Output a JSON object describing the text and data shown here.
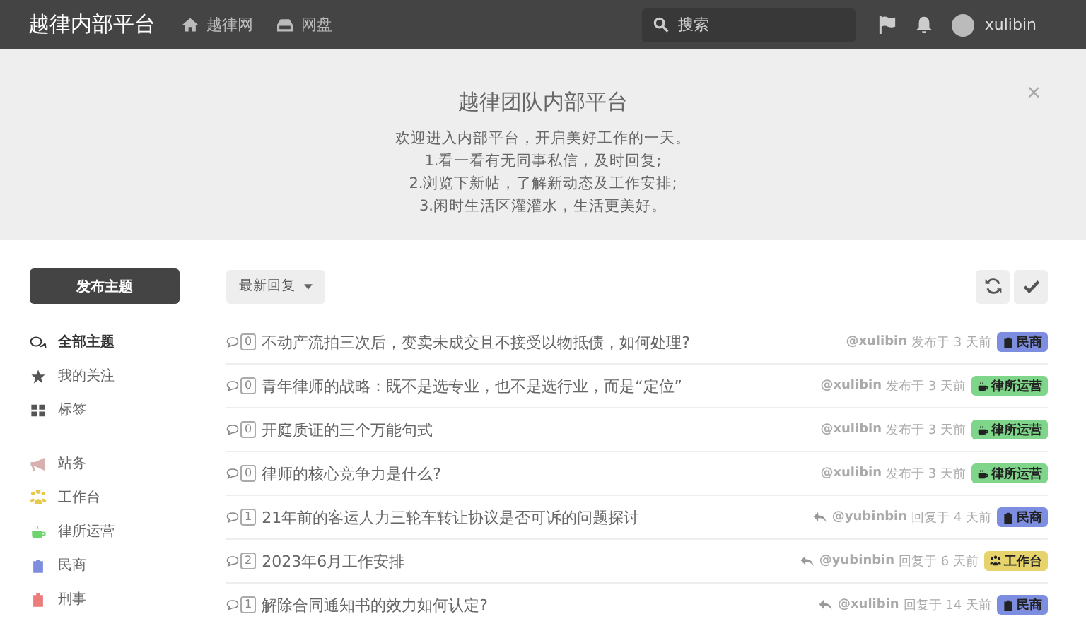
{
  "header": {
    "logo": "越律内部平台",
    "nav": [
      "越律网",
      "网盘"
    ],
    "search": {
      "placeholder": "搜索"
    },
    "user": "xulibin"
  },
  "banner": {
    "title": "越律团队内部平台",
    "lines": [
      "欢迎进入内部平台，开启美好工作的一天。",
      "1.看一看有无同事私信，及时回复;",
      "2.浏览下新帖，了解新动态及工作安排;",
      "3.闲时生活区灌灌水，生活更美好。"
    ],
    "close": "×"
  },
  "sidebar": {
    "button": "发布主题",
    "nav": [
      {
        "label": "全部主题",
        "selected": true
      },
      {
        "label": "我的关注",
        "selected": false
      },
      {
        "label": "标签",
        "selected": false
      }
    ],
    "tags": [
      {
        "label": "站务",
        "kind": "notice",
        "color": "#d9b0b0"
      },
      {
        "label": "工作台",
        "kind": "team",
        "color": "#e6c84a"
      },
      {
        "label": "律所运营",
        "kind": "office",
        "color": "#6fd36f"
      },
      {
        "label": "民商",
        "kind": "case",
        "color": "#7d8ee0"
      },
      {
        "label": "刑事",
        "kind": "case",
        "color": "#ec7b7b"
      }
    ]
  },
  "toolbar": {
    "sort": "最新回复"
  },
  "discussions": [
    {
      "title": "不动产流拍三次后，变卖未成交且不接受以物抵债，如何处理?",
      "replies": "0",
      "kind": "posted",
      "user": "@xulibin",
      "time": "发布于 3 天前",
      "tag": {
        "label": "民商",
        "kind": "case",
        "color": "#7d8ee0"
      }
    },
    {
      "title": "青年律师的战略：既不是选专业，也不是选行业，而是“定位”",
      "replies": "0",
      "kind": "posted",
      "user": "@xulibin",
      "time": "发布于 3 天前",
      "tag": {
        "label": "律所运营",
        "kind": "office",
        "color": "#7fd68a"
      }
    },
    {
      "title": "开庭质证的三个万能句式",
      "replies": "0",
      "kind": "posted",
      "user": "@xulibin",
      "time": "发布于 3 天前",
      "tag": {
        "label": "律所运营",
        "kind": "office",
        "color": "#7fd68a"
      }
    },
    {
      "title": "律师的核心竞争力是什么?",
      "replies": "0",
      "kind": "posted",
      "user": "@xulibin",
      "time": "发布于 3 天前",
      "tag": {
        "label": "律所运营",
        "kind": "office",
        "color": "#7fd68a"
      }
    },
    {
      "title": "21年前的客运人力三轮车转让协议是否可诉的问题探讨",
      "replies": "1",
      "kind": "replied",
      "user": "@yubinbin",
      "time": "回复于 4 天前",
      "tag": {
        "label": "民商",
        "kind": "case",
        "color": "#7d8ee0"
      }
    },
    {
      "title": "2023年6月工作安排",
      "replies": "2",
      "kind": "replied",
      "user": "@yubinbin",
      "time": "回复于 6 天前",
      "tag": {
        "label": "工作台",
        "kind": "team",
        "color": "#e6d36c"
      }
    },
    {
      "title": "解除合同通知书的效力如何认定?",
      "replies": "1",
      "kind": "replied",
      "user": "@xulibin",
      "time": "回复于 14 天前",
      "tag": {
        "label": "民商",
        "kind": "case",
        "color": "#7d8ee0"
      }
    }
  ]
}
